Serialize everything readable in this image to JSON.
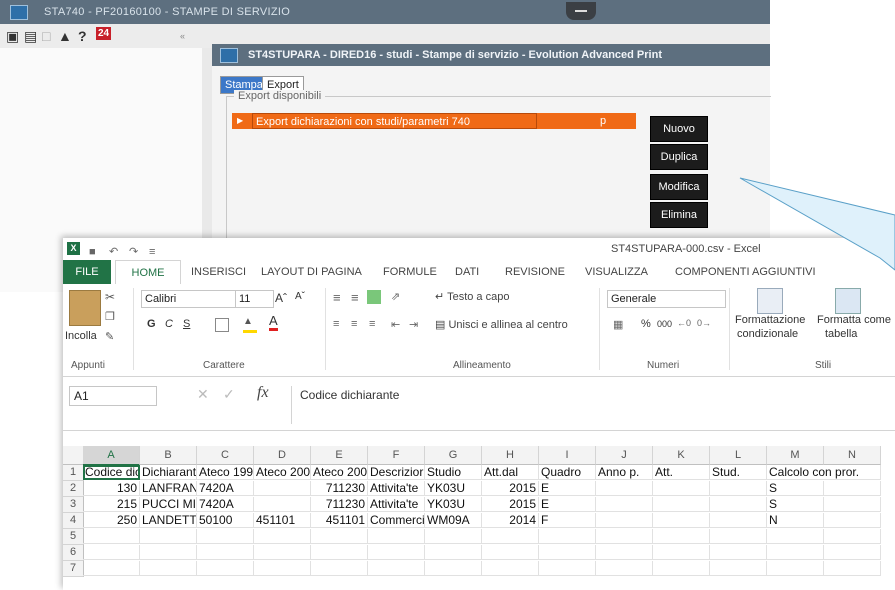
{
  "bg_app": {
    "title": "STA740 - PF20160100 - STAMPE DI SERVIZIO",
    "toolbar_badge": "24"
  },
  "print_window": {
    "title": "ST4STUPARA - DIRED16 - studi - Stampe di servizio - Evolution Advanced Print",
    "tabs": [
      "Stampa",
      "Export"
    ],
    "group_label": "Export disponibili",
    "export_row": {
      "name": "Export dichiarazioni con studi/parametri 740",
      "code": "p"
    },
    "buttons": {
      "nuovo": "Nuovo",
      "duplica": "Duplica",
      "modifica": "Modifica",
      "elimina": "Elimina"
    },
    "accent_color": "#f06a16"
  },
  "excel": {
    "title": "ST4STUPARA-000.csv - Excel",
    "tabs": [
      "FILE",
      "HOME",
      "INSERISCI",
      "LAYOUT DI PAGINA",
      "FORMULE",
      "DATI",
      "REVISIONE",
      "VISUALIZZA",
      "COMPONENTI AGGIUNTIVI"
    ],
    "ribbon": {
      "paste_label": "Incolla",
      "font_name": "Calibri",
      "font_size": "11",
      "bold": "G",
      "italic": "C",
      "underline": "S",
      "wrap_text": "Testo a capo",
      "merge_center": "Unisci e allinea al centro",
      "number_format": "Generale",
      "percent": "%",
      "thousands": "000",
      "cond_format_1": "Formattazione",
      "cond_format_2": "condizionale",
      "format_table_1": "Formatta come",
      "format_table_2": "tabella",
      "groups": [
        "Appunti",
        "Carattere",
        "Allineamento",
        "Numeri",
        "Stili"
      ]
    },
    "name_box": "A1",
    "fx": "fx",
    "formula_value": "Codice dichiarante",
    "columns": [
      "A",
      "B",
      "C",
      "D",
      "E",
      "F",
      "G",
      "H",
      "I",
      "J",
      "K",
      "L",
      "M",
      "N"
    ],
    "rows": [
      [
        "1",
        "Codice dic",
        "Dichiarant",
        "Ateco 199",
        "Ateco 200",
        "Ateco 200",
        "Descrizior",
        "Studio",
        "Att.dal",
        "Quadro",
        "Anno p.",
        "Att.",
        "Stud.",
        "Calcolo con pror.",
        ""
      ],
      [
        "2",
        "130",
        "LANFRAN",
        "7420A",
        "",
        "711230",
        "Attivita'te",
        "YK03U",
        "2015",
        "E",
        "",
        "",
        "",
        "S",
        ""
      ],
      [
        "3",
        "215",
        "PUCCI MIF",
        "7420A",
        "",
        "711230",
        "Attivita'te",
        "YK03U",
        "2015",
        "E",
        "",
        "",
        "",
        "S",
        ""
      ],
      [
        "4",
        "250",
        "LANDETTI",
        "50100",
        "451101",
        "451101",
        "Commerci",
        "WM09A",
        "2014",
        "F",
        "",
        "",
        "",
        "N",
        ""
      ],
      [
        "5",
        "",
        "",
        "",
        "",
        "",
        "",
        "",
        "",
        "",
        "",
        "",
        "",
        "",
        ""
      ],
      [
        "6",
        "",
        "",
        "",
        "",
        "",
        "",
        "",
        "",
        "",
        "",
        "",
        "",
        "",
        ""
      ],
      [
        "7",
        "",
        "",
        "",
        "",
        "",
        "",
        "",
        "",
        "",
        "",
        "",
        "",
        "",
        ""
      ]
    ],
    "accent_color": "#217346"
  }
}
